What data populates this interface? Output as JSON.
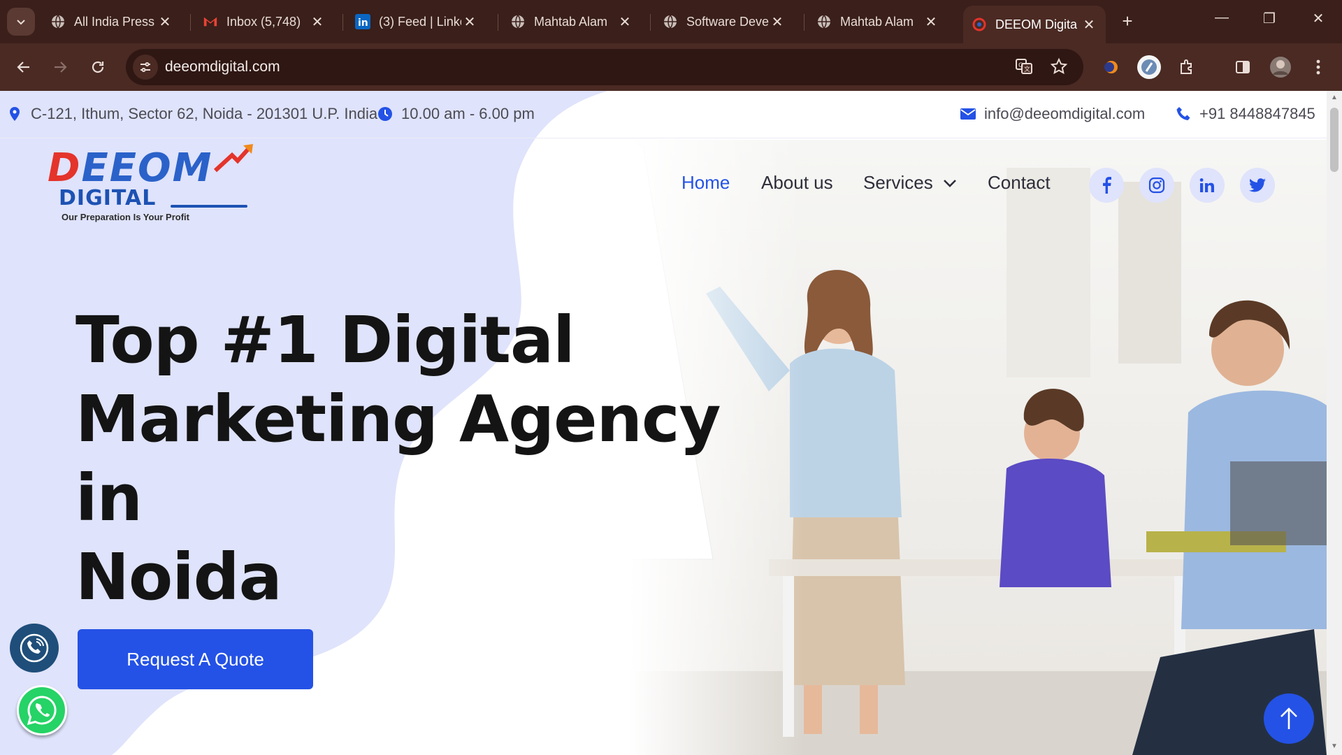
{
  "browser": {
    "tabs": [
      {
        "title": "All India Press",
        "favicon": "globe-icon"
      },
      {
        "title": "Inbox (5,748)",
        "favicon": "gmail-icon"
      },
      {
        "title": "(3) Feed | Linke",
        "favicon": "linkedin-icon"
      },
      {
        "title": "Mahtab Alam",
        "favicon": "globe-icon"
      },
      {
        "title": "Software Deve",
        "favicon": "globe-icon"
      },
      {
        "title": "Mahtab Alam",
        "favicon": "globe-icon"
      },
      {
        "title": "DEEOM Digita",
        "favicon": "deeom-icon",
        "active": true
      }
    ],
    "url": "deeomdigital.com"
  },
  "topbar": {
    "address": "C-121, Ithum, Sector 62, Noida - 201301 U.P. India",
    "hours": "10.00 am - 6.00 pm",
    "email": "info@deeomdigital.com",
    "phone": "+91 8448847845"
  },
  "logo": {
    "word_first": "D",
    "word_rest": "EEOM",
    "sub": "DIGITAL",
    "tagline": "Our Preparation Is Your Profit"
  },
  "nav": {
    "home": "Home",
    "about": "About us",
    "services": "Services",
    "contact": "Contact"
  },
  "social": [
    "facebook-icon",
    "instagram-icon",
    "linkedin-icon",
    "twitter-icon"
  ],
  "hero": {
    "line1": "Top #1 Digital",
    "line2": "Marketing Agency in",
    "line3": "Noida",
    "cta": "Request A Quote"
  },
  "colors": {
    "accent": "#2452e6",
    "blob": "#dfe3fb",
    "chrome": "#3a1f1a",
    "toolbar": "#4a2a23"
  }
}
